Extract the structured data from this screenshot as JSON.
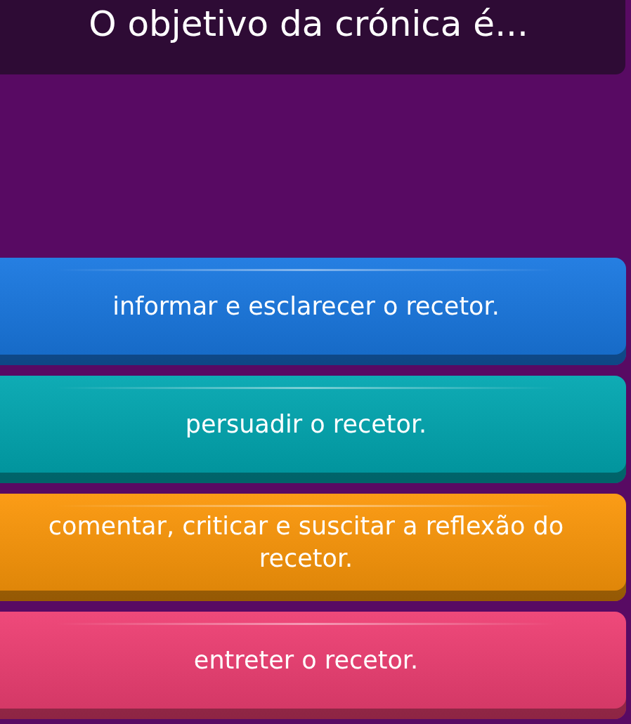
{
  "question": {
    "text": "O objetivo da crónica é..."
  },
  "answers": [
    {
      "text": "informar e esclarecer o recetor.",
      "color": "#1877e0"
    },
    {
      "text": "persuadir o recetor.",
      "color": "#00a6b0"
    },
    {
      "text": "comentar, criticar e suscitar a reflexão do recetor.",
      "color": "#fb9608"
    },
    {
      "text": "entreter o recetor.",
      "color": "#ee3e72"
    }
  ]
}
